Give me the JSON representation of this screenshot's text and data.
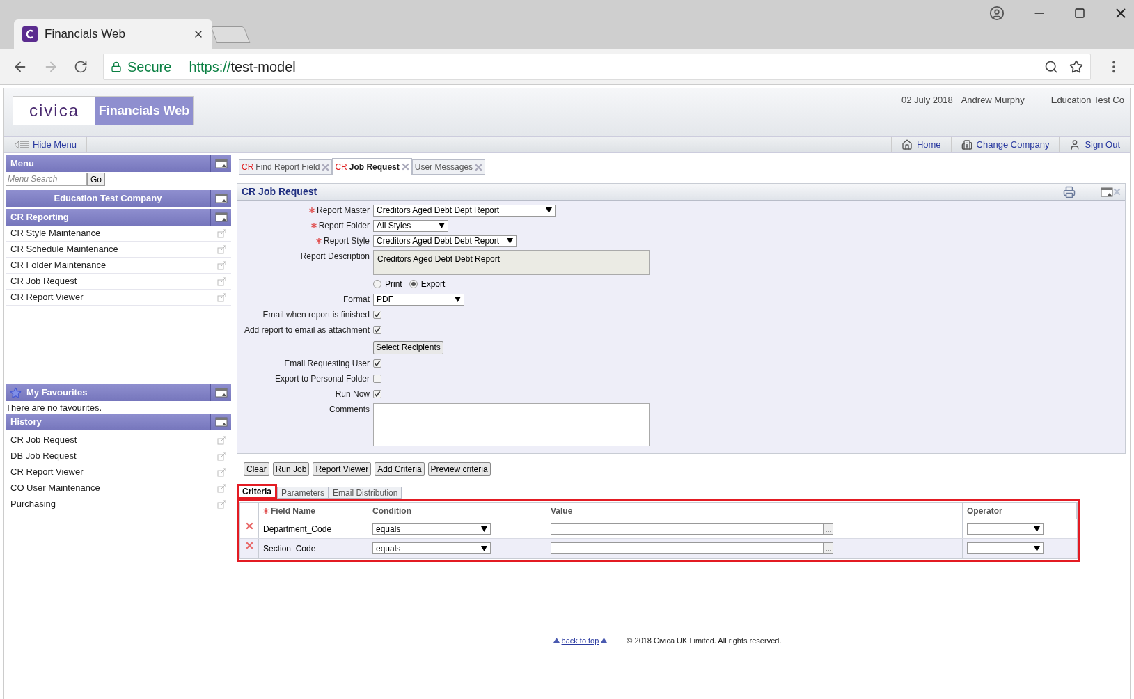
{
  "browser": {
    "tab_title": "Financials Web",
    "secure": "Secure",
    "url_scheme": "https://",
    "url_host": "test-model"
  },
  "header": {
    "logo": "civica",
    "product": "Financials Web",
    "date": "02 July 2018",
    "user": "Andrew Murphy",
    "company": "Education Test Co"
  },
  "nav": {
    "hide_menu": "Hide Menu",
    "links": [
      {
        "kind": "home",
        "label": "Home"
      },
      {
        "kind": "company",
        "label": "Change Company"
      },
      {
        "kind": "signout",
        "label": "Sign Out"
      }
    ]
  },
  "sidebar": {
    "menu": {
      "title": "Menu",
      "search_placeholder": "Menu Search",
      "go": "Go"
    },
    "company": "Education Test Company",
    "section": {
      "title": "CR Reporting",
      "items": [
        "CR Style Maintenance",
        "CR Schedule Maintenance",
        "CR Folder Maintenance",
        "CR Job Request",
        "CR Report Viewer"
      ]
    },
    "favourites": {
      "title": "My Favourites",
      "empty": "There are no favourites."
    },
    "history": {
      "title": "History",
      "items": [
        "CR Job Request",
        "DB Job Request",
        "CR Report Viewer",
        "CO User Maintenance",
        "Purchasing"
      ]
    }
  },
  "tabs": [
    {
      "prefix": "CR",
      "label": "Find Report Field",
      "selected": false
    },
    {
      "prefix": "CR",
      "label": "Job Request",
      "selected": true
    },
    {
      "label": "User Messages",
      "selected": false
    }
  ],
  "form": {
    "title": "CR Job Request",
    "rows": [
      {
        "kind": "select",
        "label": "Report Master",
        "required": true,
        "value": "Creditors Aged Debt Dept Report"
      },
      {
        "kind": "select",
        "label": "Report Folder",
        "required": true,
        "value": "All Styles"
      },
      {
        "kind": "select",
        "label": "Report Style",
        "required": true,
        "value": "Creditors Aged Debt Debt Report"
      },
      {
        "kind": "textarea",
        "label": "Report Description",
        "value": "Creditors Aged Debt Debt Report",
        "readonly": true
      },
      {
        "kind": "radio",
        "options": [
          {
            "label": "Print",
            "selected": false
          },
          {
            "label": "Export",
            "selected": true
          }
        ]
      },
      {
        "kind": "select",
        "label": "Format",
        "required": false,
        "value": "PDF"
      },
      {
        "kind": "checkbox",
        "label": "Email when report is finished",
        "checked": true
      },
      {
        "kind": "checkbox",
        "label": "Add report to email as attachment",
        "checked": true
      },
      {
        "kind": "button",
        "label": "Select Recipients"
      },
      {
        "kind": "checkbox",
        "label": "Email Requesting User",
        "checked": true
      },
      {
        "kind": "checkbox",
        "label": "Export to Personal Folder",
        "checked": false
      },
      {
        "kind": "checkbox",
        "label": "Run Now",
        "checked": true
      },
      {
        "kind": "textarea",
        "label": "Comments",
        "readonly": false
      }
    ]
  },
  "actions": [
    "Clear",
    "Run Job",
    "Report Viewer",
    "Add Criteria",
    "Preview criteria"
  ],
  "subtabs": [
    {
      "label": "Criteria",
      "selected": true
    },
    {
      "label": "Parameters",
      "selected": false
    },
    {
      "label": "Email Distribution",
      "selected": false
    }
  ],
  "criteria": {
    "columns": [
      {
        "label": "Field Name",
        "required": true
      },
      {
        "label": "Condition",
        "required": false
      },
      {
        "label": "Value",
        "required": false
      },
      {
        "label": "Operator",
        "required": false
      }
    ],
    "rows": [
      {
        "field": "Department_Code",
        "condition": "equals"
      },
      {
        "field": "Section_Code",
        "condition": "equals"
      }
    ]
  },
  "footer": {
    "back_to_top": "back to top",
    "copyright": "© 2018 Civica UK Limited. All rights reserved."
  }
}
